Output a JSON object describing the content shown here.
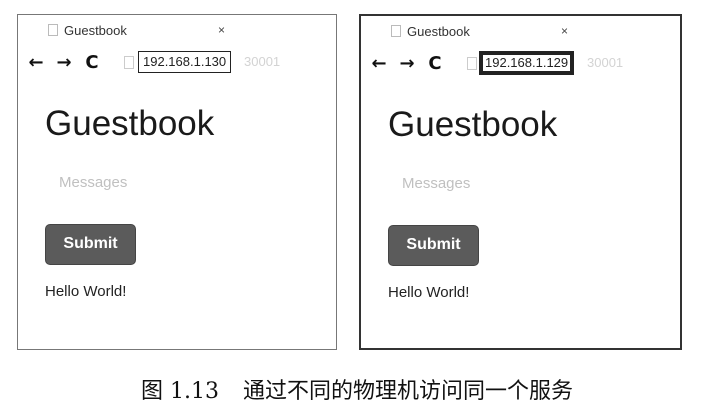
{
  "browsers": [
    {
      "tab_title": "Guestbook",
      "tab_close": "×",
      "nav": {
        "back": "←",
        "forward": "→",
        "reload": "C"
      },
      "url": "192.168.1.130",
      "url_ghost": "30001",
      "page_title": "Guestbook",
      "message_placeholder": "Messages",
      "submit_label": "Submit",
      "output_text": "Hello World!"
    },
    {
      "tab_title": "Guestbook",
      "tab_close": "×",
      "nav": {
        "back": "←",
        "forward": "→",
        "reload": "C"
      },
      "url": "192.168.1.129",
      "url_ghost": "30001",
      "page_title": "Guestbook",
      "message_placeholder": "Messages",
      "submit_label": "Submit",
      "output_text": "Hello World!"
    }
  ],
  "caption": {
    "figure_number": "图 1.13",
    "text": "通过不同的物理机访问同一个服务"
  }
}
